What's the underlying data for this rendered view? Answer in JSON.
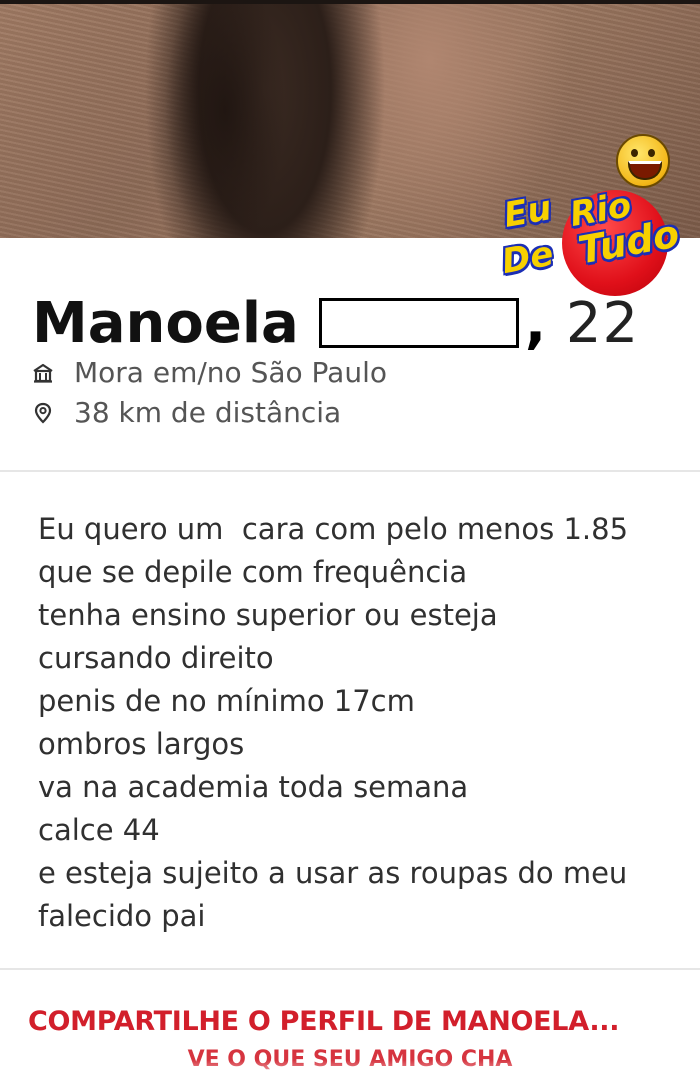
{
  "profile": {
    "name": "Manoela",
    "age_separator": ",",
    "age": "22",
    "location": "Mora em/no São Paulo",
    "distance": "38 km de distância",
    "location_icon": "home-icon",
    "distance_icon": "map-pin-icon"
  },
  "bio": {
    "lines": [
      "Eu quero um  cara com pelo menos 1.85",
      "que se depile com frequência",
      "tenha ensino superior ou esteja",
      "cursando direito",
      "penis de no mínimo 17cm",
      "ombros largos",
      "va na academia toda semana",
      "calce 44",
      "e esteja sujeito a usar as roupas do meu",
      "falecido pai"
    ]
  },
  "share": {
    "title": "COMPARTILHE O PERFIL DE MANOELA...",
    "subtitle": "VE  O QUE SEU AMIGO  CHA"
  },
  "watermark": {
    "line1a": "Eu",
    "line1b": "Rio",
    "line2a": "De",
    "line2b": "Tudo"
  },
  "colors": {
    "accent": "#d21f2b",
    "text": "#303030"
  }
}
